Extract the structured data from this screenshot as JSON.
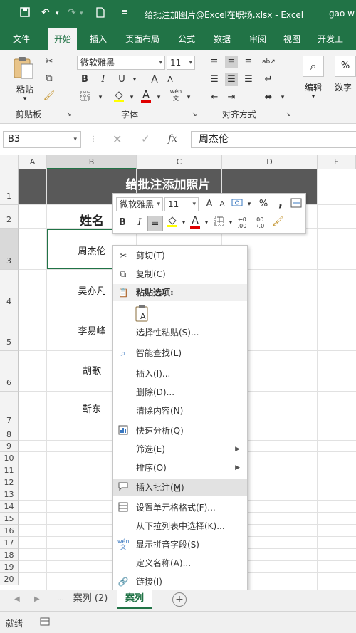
{
  "titlebar": {
    "title": "给批注加图片@Excel在职场.xlsx  -  Excel",
    "user": "gao w",
    "color": "#217346"
  },
  "tabs": [
    "文件",
    "开始",
    "插入",
    "页面布局",
    "公式",
    "数据",
    "审阅",
    "视图",
    "开发工具"
  ],
  "ribbon": {
    "paste_label": "粘贴",
    "font_name": "微软雅黑",
    "font_size": "11",
    "bold": "B",
    "italic": "I",
    "underline": "U",
    "grow_font": "A",
    "shrink_font": "A",
    "font_color_letter": "A",
    "phonetic": "wén",
    "edit_label": "编辑",
    "number_label": "数字",
    "groups": {
      "clipboard": "剪贴板",
      "font": "字体",
      "alignment": "对齐方式"
    }
  },
  "formula_bar": {
    "name_box": "B3",
    "fx": "fx",
    "value": "周杰伦"
  },
  "columns": [
    "A",
    "B",
    "C",
    "D",
    "E"
  ],
  "rows": [
    "1",
    "2",
    "3",
    "4",
    "5",
    "6",
    "7",
    "8",
    "9",
    "10",
    "11",
    "12",
    "13",
    "14",
    "15",
    "16",
    "17",
    "18",
    "19",
    "20"
  ],
  "cells": {
    "title": "给批注添加照片",
    "header_name": "姓名",
    "names": [
      "周杰伦",
      "吴亦凡",
      "李易峰",
      "胡歌",
      "靳东"
    ]
  },
  "mini_toolbar": {
    "font_name": "微软雅黑",
    "font_size": "11",
    "grow": "A",
    "shrink": "A",
    "percent": "%",
    "comma": ",",
    "bold": "B",
    "italic": "I",
    "font_color_letter": "A"
  },
  "context_menu": {
    "cut": "剪切(T)",
    "copy": "复制(C)",
    "paste_options": "粘贴选项:",
    "paste_special": "选择性粘贴(S)...",
    "smart_lookup": "智能查找(L)",
    "insert": "插入(I)...",
    "delete": "删除(D)...",
    "clear_contents": "清除内容(N)",
    "quick_analysis": "快速分析(Q)",
    "filter": "筛选(E)",
    "sort": "排序(O)",
    "insert_comment": "插入批注(M)",
    "format_cells": "设置单元格格式(F)...",
    "pick_from_list": "从下拉列表中选择(K)...",
    "show_phonetic": "显示拼音字段(S)",
    "define_name": "定义名称(A)...",
    "link": "链接(I)"
  },
  "sheet_tabs": [
    "案列 (2)",
    "案列"
  ],
  "status": {
    "ready": "就绪"
  }
}
